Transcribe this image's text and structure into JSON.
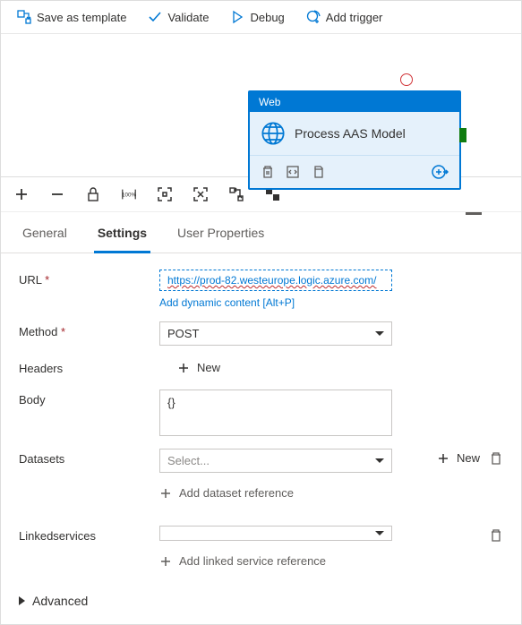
{
  "toolbar": {
    "save_template": "Save as template",
    "validate": "Validate",
    "debug": "Debug",
    "add_trigger": "Add trigger"
  },
  "node": {
    "type": "Web",
    "title": "Process AAS Model"
  },
  "icons_toolbar": {
    "percent_label": "100%"
  },
  "tabs": {
    "general": "General",
    "settings": "Settings",
    "user_properties": "User Properties"
  },
  "form": {
    "url": {
      "label": "URL",
      "value": "https://prod-82.westeurope.logic.azure.com/",
      "dynamic": "Add dynamic content [Alt+P]"
    },
    "method": {
      "label": "Method",
      "selected": "POST"
    },
    "headers": {
      "label": "Headers",
      "new": "New"
    },
    "body": {
      "label": "Body",
      "value": "{}"
    },
    "datasets": {
      "label": "Datasets",
      "placeholder": "Select...",
      "new": "New",
      "add_reference": "Add dataset reference"
    },
    "linked": {
      "label": "Linkedservices",
      "add_reference": "Add linked service reference"
    },
    "advanced": "Advanced"
  }
}
